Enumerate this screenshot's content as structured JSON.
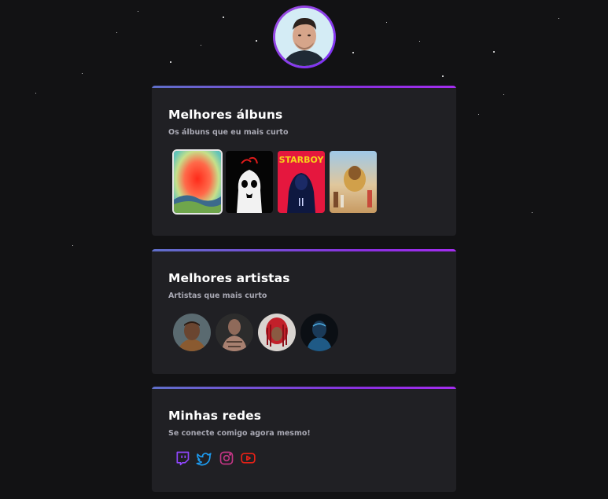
{
  "profile": {
    "avatar_icon": "user-photo"
  },
  "albums_card": {
    "title": "Melhores álbuns",
    "subtitle": "Os álbuns que eu mais curto",
    "items": [
      {
        "icon": "album-cover-red-gradient"
      },
      {
        "icon": "album-cover-black-white"
      },
      {
        "icon": "album-cover-starboy",
        "text": "STARBOY"
      },
      {
        "icon": "album-cover-desert"
      }
    ]
  },
  "artists_card": {
    "title": "Melhores artistas",
    "subtitle": "Artistas que mais curto",
    "items": [
      {
        "icon": "artist-photo-1"
      },
      {
        "icon": "artist-photo-2"
      },
      {
        "icon": "artist-photo-3"
      },
      {
        "icon": "artist-photo-4"
      }
    ]
  },
  "social_card": {
    "title": "Minhas redes",
    "subtitle": "Se conecte comigo agora mesmo!",
    "items": [
      {
        "icon": "twitch-icon",
        "color": "#9146ff"
      },
      {
        "icon": "twitter-icon",
        "color": "#1d9bf0"
      },
      {
        "icon": "instagram-icon",
        "color": "#c13584"
      },
      {
        "icon": "youtube-icon",
        "color": "#e62117"
      }
    ]
  },
  "colors": {
    "background": "#121214",
    "card": "#202024",
    "accent_start": "#5f6fc9",
    "accent_end": "#a42ef0",
    "subtitle": "#a8a8b3"
  }
}
